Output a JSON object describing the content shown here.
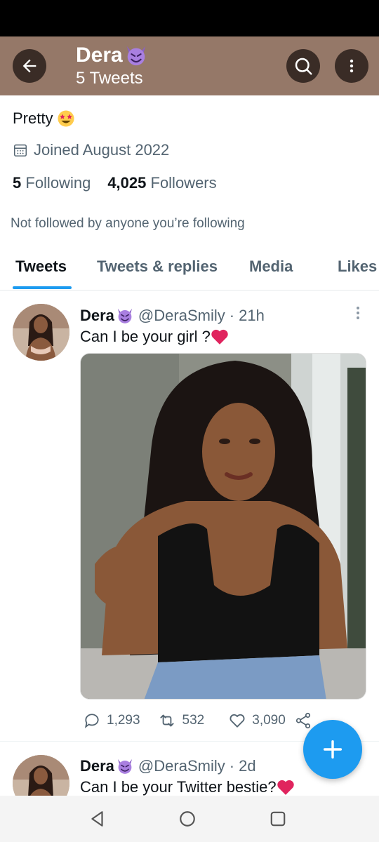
{
  "header": {
    "name": "Dera",
    "tweet_count": "5 Tweets"
  },
  "profile": {
    "bio": "Pretty",
    "joined": "Joined August 2022",
    "following_count": "5",
    "following_label": "Following",
    "followers_count": "4,025",
    "followers_label": "Followers",
    "not_followed": "Not followed by anyone you’re following"
  },
  "tabs": [
    {
      "label": "Tweets",
      "active": true
    },
    {
      "label": "Tweets & replies",
      "active": false
    },
    {
      "label": "Media",
      "active": false
    },
    {
      "label": "Likes",
      "active": false
    }
  ],
  "tweets": [
    {
      "name": "Dera",
      "handle": "@DeraSmily",
      "time": "· 21h",
      "text": "Can I be your girl ?",
      "replies": "1,293",
      "retweets": "532",
      "likes": "3,090"
    },
    {
      "name": "Dera",
      "handle": "@DeraSmily",
      "time": "· 2d",
      "text": "Can I be your Twitter bestie?"
    }
  ],
  "colors": {
    "header_bg": "#957868",
    "accent": "#1d9bf0",
    "heart": "#e0245e"
  },
  "icons": [
    "back-arrow-icon",
    "search-icon",
    "more-vertical-icon",
    "calendar-icon",
    "reply-icon",
    "retweet-icon",
    "like-icon",
    "share-icon",
    "compose-plus-icon",
    "nav-back-icon",
    "nav-home-icon",
    "nav-recents-icon"
  ]
}
